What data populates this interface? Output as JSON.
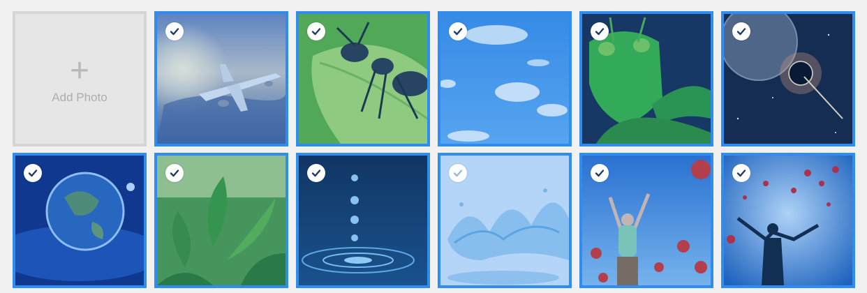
{
  "add_tile": {
    "icon": "plus-icon",
    "plus": "+",
    "label": "Add Photo"
  },
  "accent": "#2f8cf1",
  "photos": [
    {
      "subject": "airplane",
      "selected": true
    },
    {
      "subject": "ant-on-leaf",
      "selected": true
    },
    {
      "subject": "blue-sky-clouds",
      "selected": true
    },
    {
      "subject": "grasshopper",
      "selected": true
    },
    {
      "subject": "eclipse-planets",
      "selected": true
    },
    {
      "subject": "earth-from-space",
      "selected": true
    },
    {
      "subject": "green-tea-leaves",
      "selected": true
    },
    {
      "subject": "water-droplets",
      "selected": true
    },
    {
      "subject": "water-splash",
      "selected": true
    },
    {
      "subject": "woman-in-poppy-field",
      "selected": true
    },
    {
      "subject": "silhouette-with-petals",
      "selected": true
    }
  ]
}
